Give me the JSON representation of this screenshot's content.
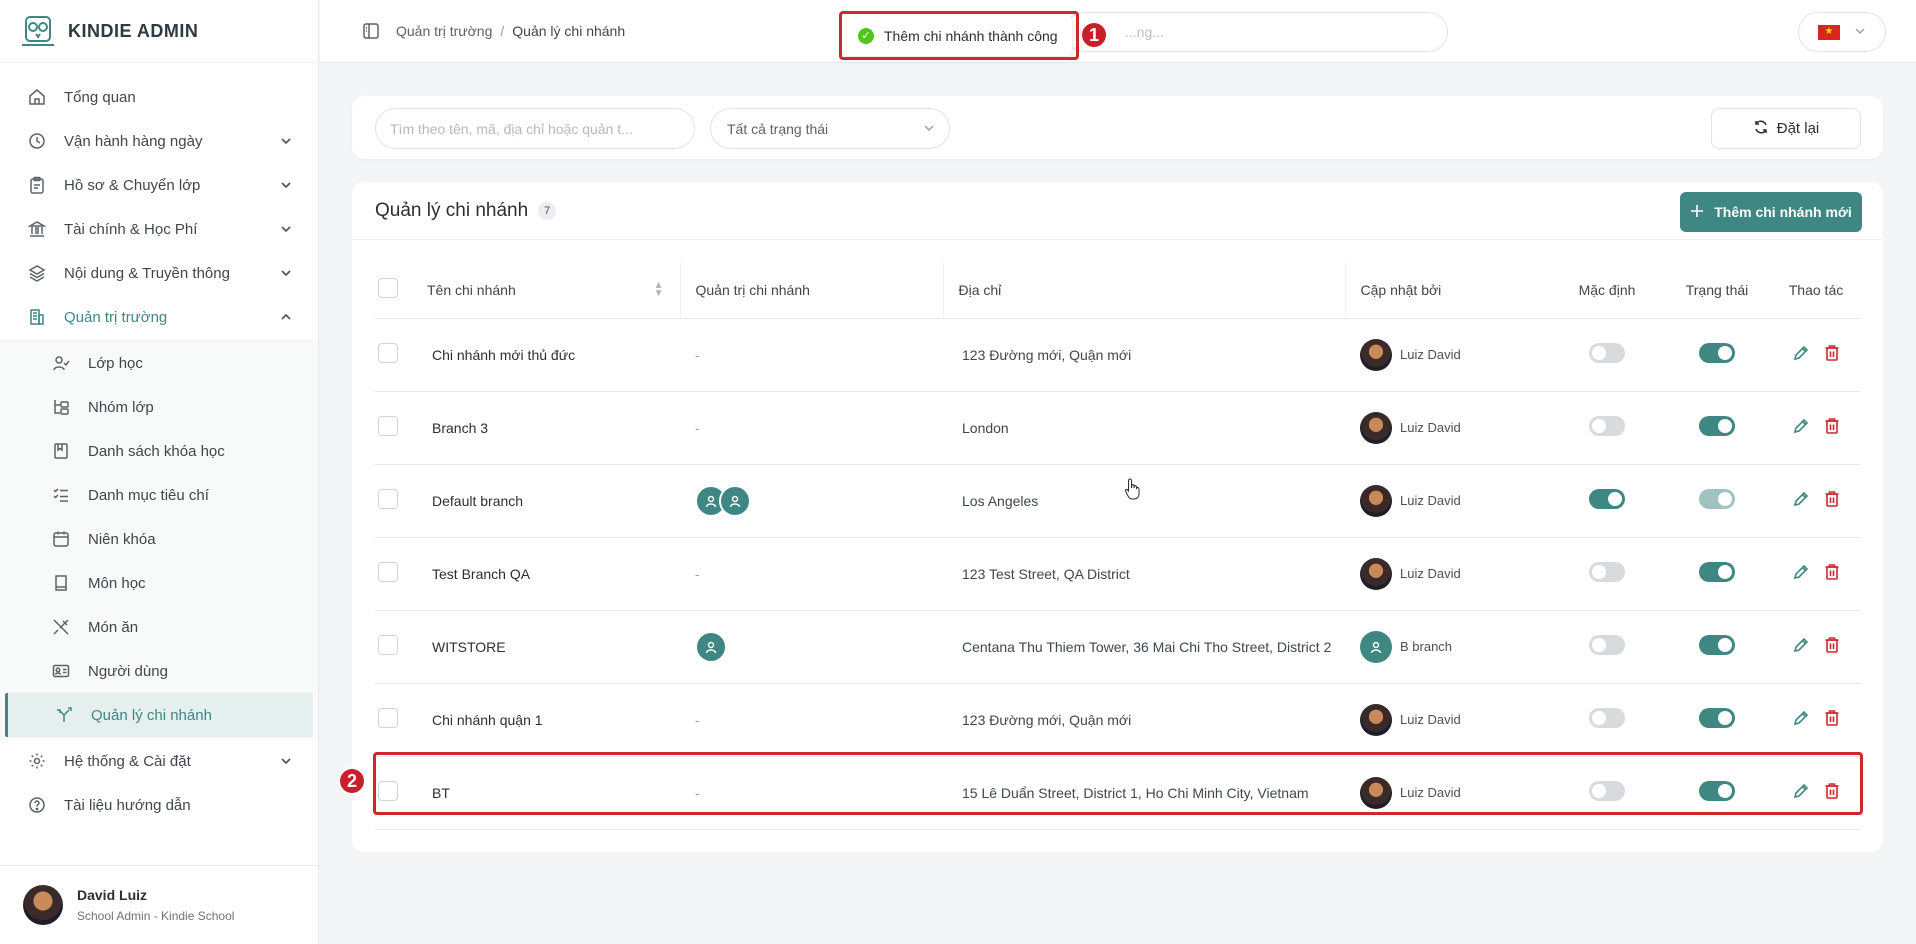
{
  "app": {
    "brand": "KINDIE ADMIN"
  },
  "sidebar": {
    "items": [
      {
        "label": "Tổng quan",
        "icon": "home-icon"
      },
      {
        "label": "Vận hành hàng ngày",
        "icon": "clock-icon"
      },
      {
        "label": "Hồ sơ & Chuyển lớp",
        "icon": "clipboard-icon"
      },
      {
        "label": "Tài chính & Học Phí",
        "icon": "bank-icon"
      },
      {
        "label": "Nội dung & Truyền thông",
        "icon": "layers-icon"
      },
      {
        "label": "Quản trị trường",
        "icon": "building-icon"
      }
    ],
    "subitems": [
      {
        "label": "Lớp học",
        "icon": "user-check-icon"
      },
      {
        "label": "Nhóm lớp",
        "icon": "group-icon"
      },
      {
        "label": "Danh sách khóa học",
        "icon": "book-icon"
      },
      {
        "label": "Danh mục tiêu chí",
        "icon": "checklist-icon"
      },
      {
        "label": "Niên khóa",
        "icon": "calendar-icon"
      },
      {
        "label": "Môn học",
        "icon": "notebook-icon"
      },
      {
        "label": "Món ăn",
        "icon": "utensils-icon"
      },
      {
        "label": "Người dùng",
        "icon": "id-card-icon"
      },
      {
        "label": "Quản lý chi nhánh",
        "icon": "branch-icon"
      }
    ],
    "bottom_items": [
      {
        "label": "Hệ thống & Cài đặt",
        "icon": "gear-icon"
      },
      {
        "label": "Tài liệu hướng dẫn",
        "icon": "help-icon"
      }
    ],
    "user": {
      "name": "David Luiz",
      "role": "School Admin - Kindie School"
    }
  },
  "topbar": {
    "breadcrumb": [
      "Quản trị trường",
      "Quản lý chi nhánh"
    ],
    "search_placeholder": "...ng...",
    "language": "vi"
  },
  "toast": {
    "message": "Thêm chi nhánh thành công"
  },
  "annotations": [
    "1",
    "2"
  ],
  "filters": {
    "search_placeholder": "Tìm theo tên, mã, địa chỉ hoặc quản t...",
    "status_select": "Tất cả trạng thái",
    "reset_label": "Đặt lại"
  },
  "main": {
    "title": "Quản lý chi nhánh",
    "count": "7",
    "add_label": "Thêm chi nhánh mới",
    "columns": {
      "name": "Tên chi nhánh",
      "admin": "Quản trị chi nhánh",
      "address": "Địa chỉ",
      "updated_by": "Cập nhật bởi",
      "default": "Mặc định",
      "status": "Trạng thái",
      "actions": "Thao tác"
    },
    "rows": [
      {
        "name": "Chi nhánh mới thủ đức",
        "admin": "-",
        "address": "123 Đường mới, Quận mới",
        "updated_by": "Luiz David",
        "default": false,
        "status": true
      },
      {
        "name": "Branch 3",
        "admin": "-",
        "address": "London",
        "updated_by": "Luiz David",
        "default": false,
        "status": true
      },
      {
        "name": "Default branch",
        "admin": "",
        "address": "Los Angeles",
        "updated_by": "Luiz David",
        "default": true,
        "status": true
      },
      {
        "name": "Test Branch QA",
        "admin": "-",
        "address": "123 Test Street, QA District",
        "updated_by": "Luiz David",
        "default": false,
        "status": true
      },
      {
        "name": "WITSTORE",
        "admin": "",
        "address": "Centana Thu Thiem Tower, 36 Mai Chi Tho Street, District 2",
        "updated_by": "B branch",
        "default": false,
        "status": true
      },
      {
        "name": "Chi nhánh quận 1",
        "admin": "-",
        "address": "123 Đường mới, Quận mới",
        "updated_by": "Luiz David",
        "default": false,
        "status": true
      },
      {
        "name": "BT",
        "admin": "-",
        "address": "15 Lê Duẩn Street, District 1, Ho Chi Minh City, Vietnam",
        "updated_by": "Luiz David",
        "default": false,
        "status": true
      }
    ]
  },
  "colors": {
    "accent": "#3e8782",
    "danger": "#d0262d",
    "success": "#52c41a"
  }
}
